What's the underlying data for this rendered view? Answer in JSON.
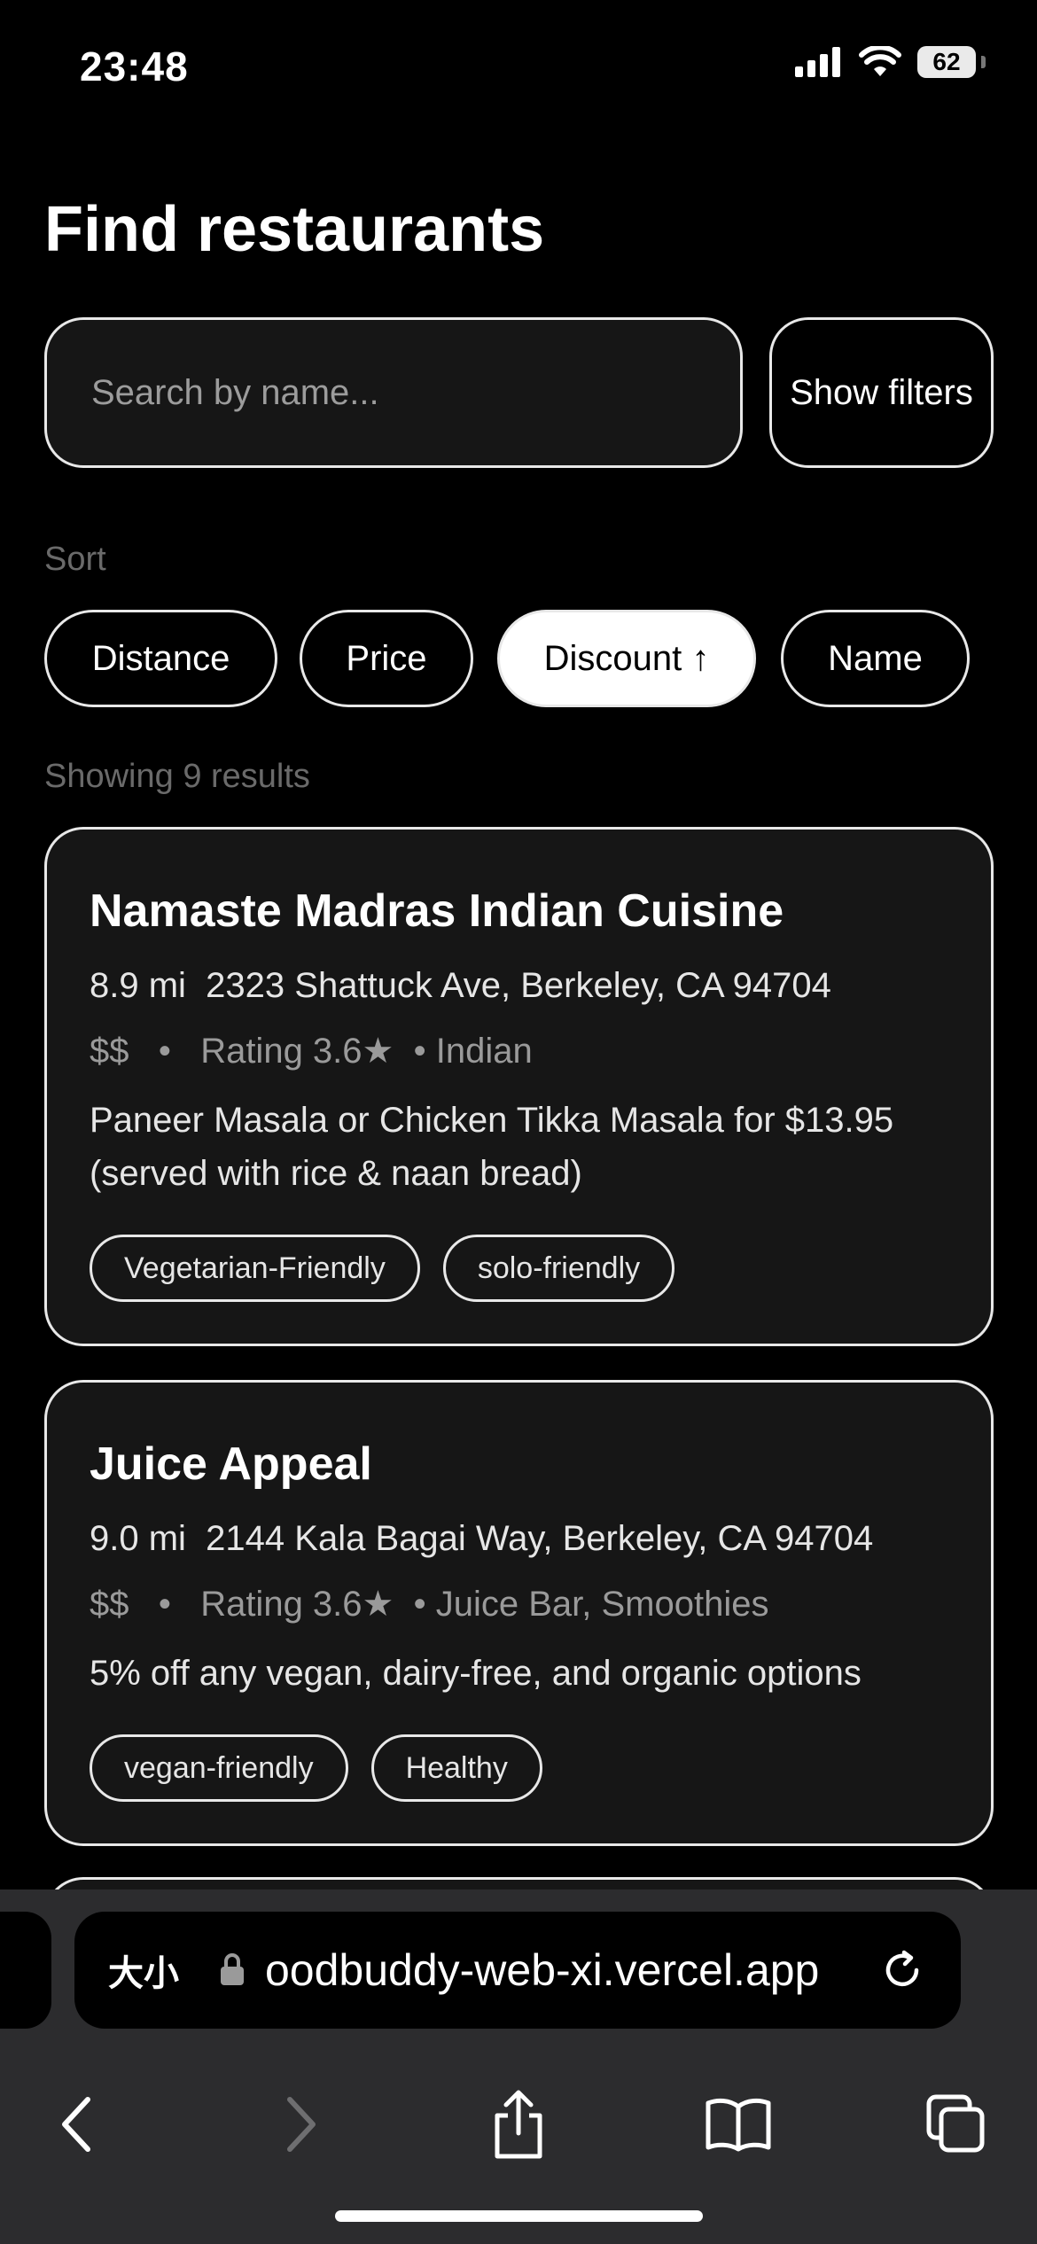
{
  "status_bar": {
    "time": "23:48",
    "battery": "62"
  },
  "page": {
    "title": "Find restaurants"
  },
  "search": {
    "placeholder": "Search by name...",
    "filters_button": "Show filters"
  },
  "sort": {
    "label": "Sort",
    "options": [
      {
        "label": "Distance",
        "active": false
      },
      {
        "label": "Price",
        "active": false
      },
      {
        "label": "Discount ↑",
        "active": true
      },
      {
        "label": "Name",
        "active": false
      }
    ]
  },
  "results": {
    "count_text": "Showing 9 results",
    "items": [
      {
        "name": "Namaste Madras Indian Cuisine",
        "distance": "8.9 mi",
        "address": "2323 Shattuck Ave, Berkeley, CA 94704",
        "price": "$$",
        "rating": "Rating 3.6★",
        "cuisine": "• Indian",
        "description": "Paneer Masala or Chicken Tikka Masala for $13.95 (served with rice & naan bread)",
        "tags": [
          "Vegetarian-Friendly",
          "solo-friendly"
        ]
      },
      {
        "name": "Juice Appeal",
        "distance": "9.0 mi",
        "address": "2144 Kala Bagai Way, Berkeley, CA 94704",
        "price": "$$",
        "rating": "Rating 3.6★",
        "cuisine": "• Juice Bar, Smoothies",
        "description": "5% off any vegan, dairy-free, and organic options",
        "tags": [
          "vegan-friendly",
          "Healthy"
        ]
      }
    ]
  },
  "browser": {
    "reader_label": "大小",
    "url": "oodbuddy-web-xi.vercel.app"
  },
  "icons": {
    "status": [
      "cellular-signal-icon",
      "wifi-icon",
      "battery-icon"
    ],
    "browser": [
      "lock-icon",
      "reload-icon"
    ],
    "toolbar": [
      "back-icon",
      "forward-icon",
      "share-icon",
      "bookmarks-icon",
      "tabs-icon"
    ]
  }
}
